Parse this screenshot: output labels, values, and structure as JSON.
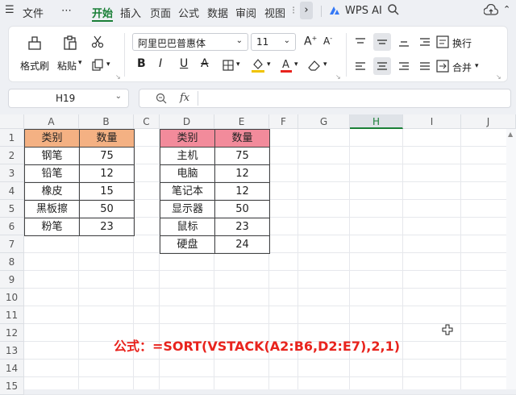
{
  "menubar": {
    "menu_icon": "☰",
    "file": "文件",
    "more": "⋯",
    "tabs": [
      "开始",
      "插入",
      "页面",
      "公式",
      "数据",
      "审阅",
      "视图"
    ],
    "wps_ai": "WPS AI"
  },
  "ribbon": {
    "format_painter": "格式刷",
    "paste": "粘贴",
    "font_name": "阿里巴巴普惠体",
    "font_size": "11",
    "wrap": "换行",
    "merge": "合并",
    "bold": "B",
    "italic": "I",
    "underline": "U",
    "strike": "A"
  },
  "formula_bar": {
    "cell_ref": "H19",
    "fx": "fx",
    "value": ""
  },
  "columns": [
    "A",
    "B",
    "C",
    "D",
    "E",
    "F",
    "G",
    "H",
    "I",
    "J"
  ],
  "rows": [
    "1",
    "2",
    "3",
    "4",
    "5",
    "6",
    "7",
    "8",
    "9",
    "10",
    "11",
    "12",
    "13",
    "14",
    "15"
  ],
  "table1": {
    "headers": [
      "类别",
      "数量"
    ],
    "rows": [
      [
        "钢笔",
        "75"
      ],
      [
        "铅笔",
        "12"
      ],
      [
        "橡皮",
        "15"
      ],
      [
        "黑板擦",
        "50"
      ],
      [
        "粉笔",
        "23"
      ]
    ]
  },
  "table2": {
    "headers": [
      "类别",
      "数量"
    ],
    "rows": [
      [
        "主机",
        "75"
      ],
      [
        "电脑",
        "12"
      ],
      [
        "笔记本",
        "12"
      ],
      [
        "显示器",
        "50"
      ],
      [
        "鼠标",
        "23"
      ],
      [
        "硬盘",
        "24"
      ]
    ]
  },
  "annotation": "公式：=SORT(VSTACK(A2:B6,D2:E7),2,1)",
  "colors": {
    "accent": "#1a7f37",
    "header1": "#f4b183",
    "header2": "#f28b9b",
    "annotation": "#e8231d",
    "selected_col": "#dfe3e8"
  }
}
